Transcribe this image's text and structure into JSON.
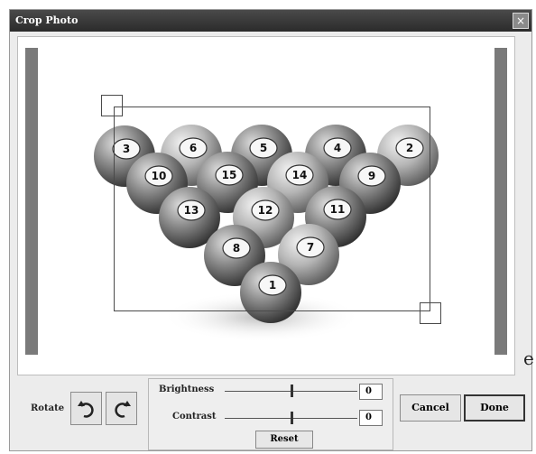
{
  "window": {
    "title": "Crop Photo",
    "close_glyph": "×"
  },
  "preview": {
    "balls": [
      "3",
      "6",
      "5",
      "4",
      "2",
      "10",
      "15",
      "14",
      "9",
      "13",
      "12",
      "11",
      "8",
      "7",
      "1"
    ]
  },
  "stray_text": "e",
  "rotate": {
    "label": "Rotate",
    "ccw_icon": "rotate-ccw-icon",
    "cw_icon": "rotate-cw-icon"
  },
  "adjust": {
    "brightness_label": "Brightness",
    "brightness_value": "0",
    "contrast_label": "Contrast",
    "contrast_value": "0",
    "reset_label": "Reset",
    "slider_level": 0.5
  },
  "buttons": {
    "cancel_label": "Cancel",
    "done_label": "Done"
  }
}
